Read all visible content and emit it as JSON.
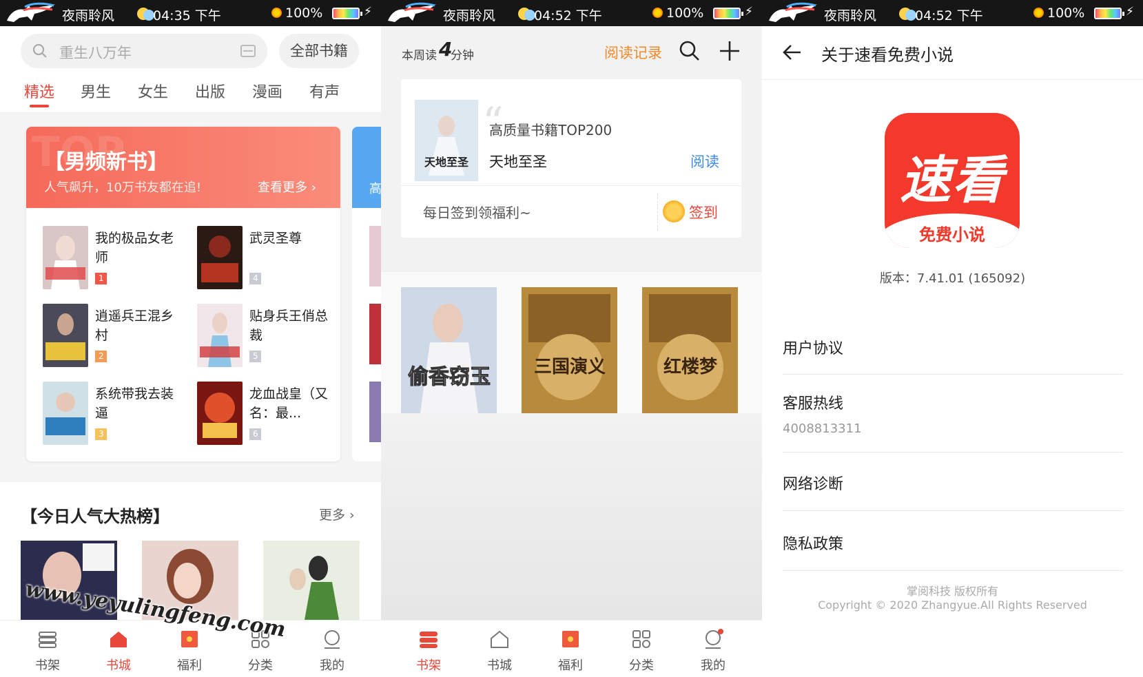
{
  "status_bars": [
    {
      "name": "夜雨聆风",
      "time": "04:35 下午",
      "battery": "100%"
    },
    {
      "name": "夜雨聆风",
      "time": "04:52 下午",
      "battery": "100%"
    },
    {
      "name": "夜雨聆风",
      "time": "04:52 下午",
      "battery": "100%"
    }
  ],
  "store": {
    "search_placeholder": "重生八万年",
    "all_books": "全部书籍",
    "tabs": [
      "精选",
      "男生",
      "女生",
      "出版",
      "漫画",
      "有声"
    ],
    "active_tab": "精选",
    "card": {
      "watermark": "TOP",
      "title": "【男频新书】",
      "subtitle": "人气飙升，10万书友都在追!",
      "more": "查看更多 ›",
      "books": [
        {
          "title": "我的极品女老师",
          "rank": "1"
        },
        {
          "title": "武灵圣尊",
          "rank": "4"
        },
        {
          "title": "逍遥兵王混乡村",
          "rank": "2"
        },
        {
          "title": "贴身兵王俏总裁",
          "rank": "5"
        },
        {
          "title": "系统带我去装逼",
          "rank": "3"
        },
        {
          "title": "龙血战皇（又名：最...",
          "rank": "6"
        }
      ]
    },
    "peek_card": {
      "label": "高"
    },
    "hot_title": "【今日人气大热榜】",
    "hot_more": "更多 ›",
    "site_watermark": "www.yeyulingfeng.com"
  },
  "nav_labels": [
    "书架",
    "书城",
    "福利",
    "分类",
    "我的"
  ],
  "nav_active": {
    "left": "书城",
    "middle": "书架"
  },
  "accent_color": "#e8483a",
  "shelf": {
    "weekly_label": "本周读",
    "weekly_minutes": "4",
    "weekly_unit": "分钟",
    "read_records": "阅读记录",
    "recommend": {
      "caption": "高质量书籍TOP200",
      "book": "天地至圣",
      "read": "阅读",
      "cover_text": "天地至圣"
    },
    "signin_text": "每日签到领福利~",
    "signin_button": "签到",
    "books": [
      "偷香窃玉",
      "三国演义",
      "红楼梦"
    ]
  },
  "about": {
    "title": "关于速看免费小说",
    "logo_main": "速看",
    "logo_sub": "免费小说",
    "version": "版本：7.41.01 (165092)",
    "items": [
      "用户协议",
      "客服热线",
      "网络诊断",
      "隐私政策"
    ],
    "hotline_number": "4008813311",
    "copyright_cn": "掌阅科技 版权所有",
    "copyright_en": "Copyright © 2020 Zhangyue.All Rights Reserved"
  }
}
